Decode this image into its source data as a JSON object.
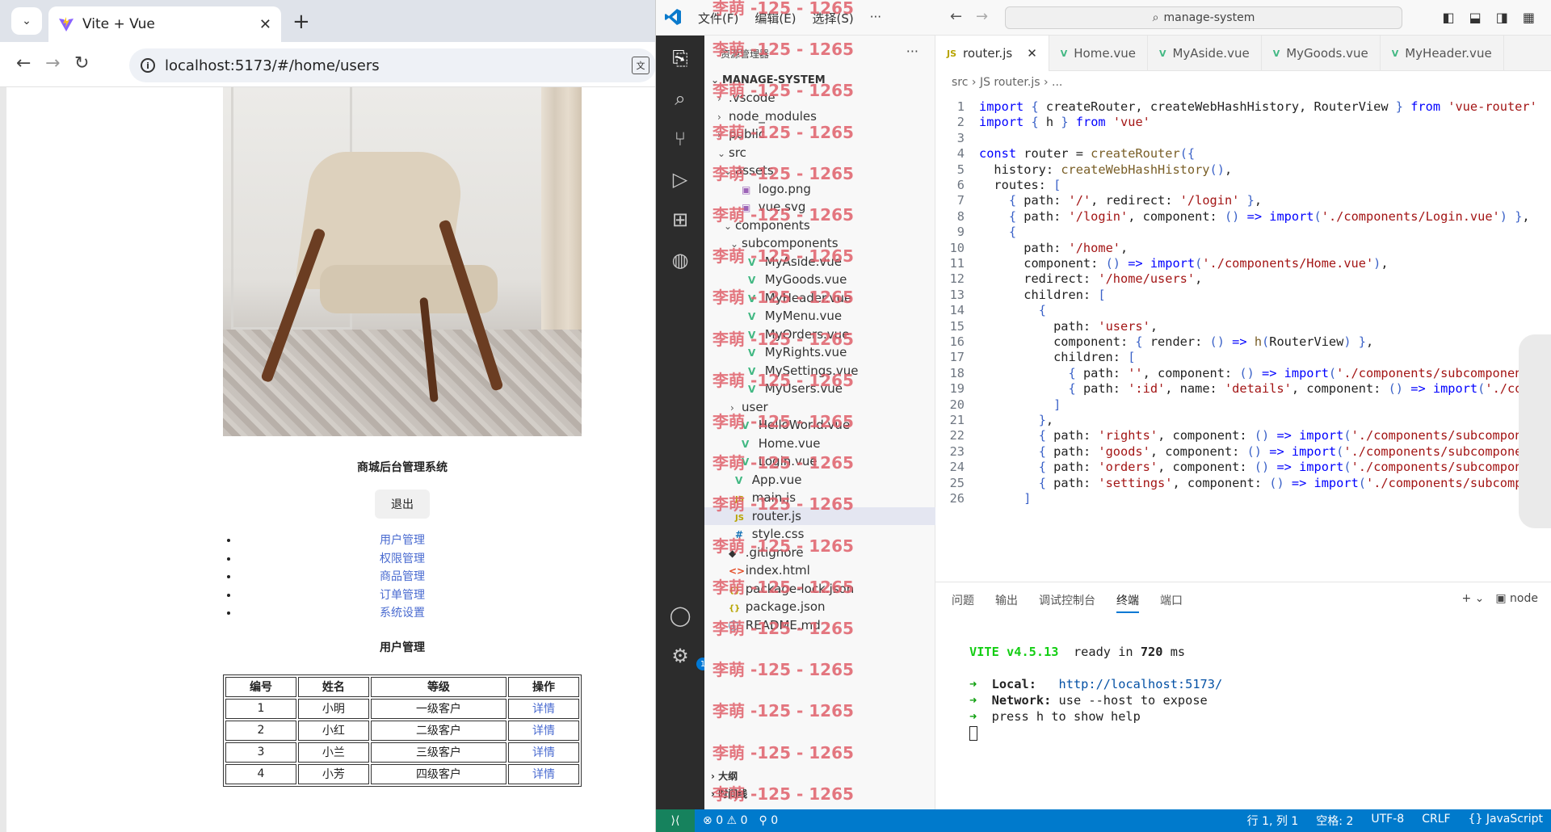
{
  "browser": {
    "tab_title": "Vite + Vue",
    "url": "localhost:5173/#/home/users",
    "page": {
      "app_title": "商城后台管理系统",
      "logout_label": "退出",
      "menu": [
        "用户管理",
        "权限管理",
        "商品管理",
        "订单管理",
        "系统设置"
      ],
      "section_title": "用户管理",
      "table": {
        "headers": [
          "编号",
          "姓名",
          "等级",
          "操作"
        ],
        "rows": [
          [
            "1",
            "小明",
            "一级客户",
            "详情"
          ],
          [
            "2",
            "小红",
            "二级客户",
            "详情"
          ],
          [
            "3",
            "小兰",
            "三级客户",
            "详情"
          ],
          [
            "4",
            "小芳",
            "四级客户",
            "详情"
          ]
        ]
      }
    }
  },
  "vscode": {
    "menu": [
      "文件(F)",
      "编辑(E)",
      "选择(S)",
      "···"
    ],
    "search": "manage-system",
    "explorer_title": "资源管理器",
    "project": "MANAGE-SYSTEM",
    "tree": [
      {
        "chev": "›",
        "icon": "",
        "label": ".vscode",
        "indent": 1
      },
      {
        "chev": "›",
        "icon": "",
        "label": "node_modules",
        "indent": 1
      },
      {
        "chev": "›",
        "icon": "",
        "label": "public",
        "indent": 1
      },
      {
        "chev": "⌄",
        "icon": "",
        "label": "src",
        "indent": 1
      },
      {
        "chev": "⌄",
        "icon": "",
        "label": "assets",
        "indent": 2
      },
      {
        "chev": "",
        "icon": "png",
        "label": "logo.png",
        "indent": 3
      },
      {
        "chev": "",
        "icon": "png",
        "label": "vue.svg",
        "indent": 3
      },
      {
        "chev": "⌄",
        "icon": "",
        "label": "components",
        "indent": 2
      },
      {
        "chev": "⌄",
        "icon": "",
        "label": "subcomponents",
        "indent": 3
      },
      {
        "chev": "",
        "icon": "vue",
        "label": "MyAside.vue",
        "indent": 4
      },
      {
        "chev": "",
        "icon": "vue",
        "label": "MyGoods.vue",
        "indent": 4
      },
      {
        "chev": "",
        "icon": "vue",
        "label": "MyHeader.vue",
        "indent": 4
      },
      {
        "chev": "",
        "icon": "vue",
        "label": "MyMenu.vue",
        "indent": 4
      },
      {
        "chev": "",
        "icon": "vue",
        "label": "MyOrders.vue",
        "indent": 4
      },
      {
        "chev": "",
        "icon": "vue",
        "label": "MyRights.vue",
        "indent": 4
      },
      {
        "chev": "",
        "icon": "vue",
        "label": "MySettings.vue",
        "indent": 4
      },
      {
        "chev": "",
        "icon": "vue",
        "label": "MyUsers.vue",
        "indent": 4
      },
      {
        "chev": "›",
        "icon": "",
        "label": "user",
        "indent": 3
      },
      {
        "chev": "",
        "icon": "vue",
        "label": "HelloWorld.vue",
        "indent": 3
      },
      {
        "chev": "",
        "icon": "vue",
        "label": "Home.vue",
        "indent": 3
      },
      {
        "chev": "",
        "icon": "vue",
        "label": "Login.vue",
        "indent": 3
      },
      {
        "chev": "",
        "icon": "vue",
        "label": "App.vue",
        "indent": 2
      },
      {
        "chev": "",
        "icon": "js",
        "label": "main.js",
        "indent": 2
      },
      {
        "chev": "",
        "icon": "js",
        "label": "router.js",
        "indent": 2,
        "selected": true
      },
      {
        "chev": "",
        "icon": "css",
        "label": "style.css",
        "indent": 2
      },
      {
        "chev": "",
        "icon": "git",
        "label": ".gitignore",
        "indent": 1
      },
      {
        "chev": "",
        "icon": "html",
        "label": "index.html",
        "indent": 1
      },
      {
        "chev": "",
        "icon": "json",
        "label": "package-lock.json",
        "indent": 1
      },
      {
        "chev": "",
        "icon": "json",
        "label": "package.json",
        "indent": 1
      },
      {
        "chev": "",
        "icon": "md",
        "label": "README.md",
        "indent": 1
      }
    ],
    "outline_label": "大纲",
    "timeline_label": "时间线",
    "tabs": [
      {
        "label": "router.js",
        "icon": "js",
        "active": true
      },
      {
        "label": "Home.vue",
        "icon": "vue"
      },
      {
        "label": "MyAside.vue",
        "icon": "vue"
      },
      {
        "label": "MyGoods.vue",
        "icon": "vue"
      },
      {
        "label": "MyHeader.vue",
        "icon": "vue"
      }
    ],
    "breadcrumb": "src  ›  JS router.js  ›  ...",
    "code": [
      "import { createRouter, createWebHashHistory, RouterView } from 'vue-router'",
      "import { h } from 'vue'",
      "",
      "const router = createRouter({",
      "  history: createWebHashHistory(),",
      "  routes: [",
      "    { path: '/', redirect: '/login' },",
      "    { path: '/login', component: () => import('./components/Login.vue') },",
      "    {",
      "      path: '/home',",
      "      component: () => import('./components/Home.vue'),",
      "      redirect: '/home/users',",
      "      children: [",
      "        {",
      "          path: 'users',",
      "          component: { render: () => h(RouterView) },",
      "          children: [",
      "            { path: '', component: () => import('./components/subcomponents/MyUsers.vue') },",
      "            { path: ':id', name: 'details', component: () => import('./components/user/MyDetails.vue') }",
      "          ]",
      "        },",
      "        { path: 'rights', component: () => import('./components/subcomponents/MyRights.vue') },",
      "        { path: 'goods', component: () => import('./components/subcomponents/MyGoods.vue') },",
      "        { path: 'orders', component: () => import('./components/subcomponents/MyOrders.vue') },",
      "        { path: 'settings', component: () => import('./components/subcomponents/MySettings.vue') },",
      "      ]"
    ],
    "panel_tabs": [
      "问题",
      "输出",
      "调试控制台",
      "终端",
      "端口"
    ],
    "terminal_shell": "node",
    "terminal": {
      "vite": "VITE v4.5.13",
      "ready": "ready in",
      "ms": "720",
      "ms_unit": "ms",
      "local_label": "Local:",
      "local_url": "http://localhost:5173/",
      "network_label": "Network:",
      "network_text": "use --host to expose",
      "help": "press h to show help"
    },
    "status": {
      "errors": "0",
      "warnings": "0",
      "ports": "0",
      "position": "行 1, 列 1",
      "spaces": "空格: 2",
      "encoding": "UTF-8",
      "eol": "CRLF",
      "language": "JavaScript"
    },
    "watermark": "李萌 -125 - 1265"
  },
  "colors": {
    "accent": "#007acc",
    "vue": "#42b883",
    "link": "#4a6bd0",
    "watermark": "#e0606a"
  }
}
